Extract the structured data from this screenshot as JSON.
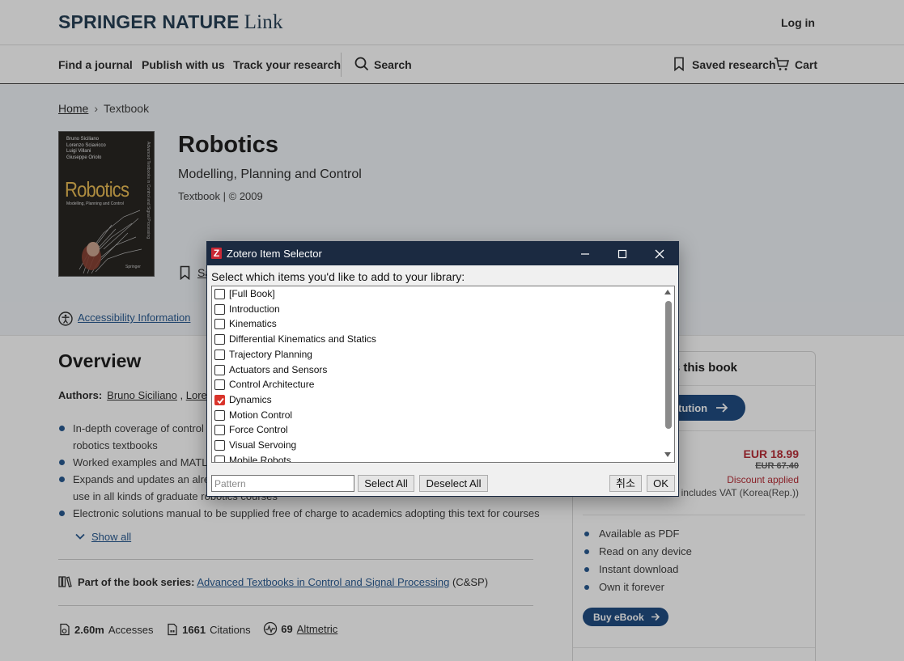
{
  "header": {
    "logo_brand": "SPRINGER NATURE",
    "logo_link": "Link",
    "login": "Log in"
  },
  "nav": {
    "find_journal": "Find a journal",
    "publish": "Publish with us",
    "track": "Track your research",
    "search": "Search",
    "saved": "Saved research",
    "cart": "Cart"
  },
  "breadcrumb": {
    "home": "Home",
    "current": "Textbook"
  },
  "cover": {
    "authors": [
      "Bruno Siciliano",
      "Lorenzo Sciavicco",
      "Luigi Villani",
      "Giuseppe Oriolo"
    ],
    "title": "Robotics",
    "subtitle": "Modelling, Planning and Control",
    "spine": "Advanced Textbooks in Control and Signal Processing",
    "publisher": "Springer"
  },
  "book": {
    "title": "Robotics",
    "subtitle": "Modelling, Planning and Control",
    "meta": "Textbook | © 2009",
    "save_peek": "Sa"
  },
  "accessibility": {
    "link": "Accessibility Information"
  },
  "overview": {
    "title": "Overview",
    "authors_label": "Authors:",
    "author1": "Bruno Siciliano",
    "author2_partial": "Loren",
    "bullets": [
      "In-depth coverage of control",
      "robotics textbooks",
      "Worked examples and MATLA",
      "Expands and updates an alrea",
      "use in all kinds of graduate robotics courses",
      "Electronic solutions manual to be supplied free of charge to academics adopting this text for courses"
    ],
    "show_all": "Show all",
    "series_label": "Part of the book series:",
    "series_link": "Advanced Textbooks in Control and Signal Processing",
    "series_abbr": "(C&SP)",
    "accesses_value": "2.60m",
    "accesses_label": "Accesses",
    "citations_value": "1661",
    "citations_label": "Citations",
    "altmetric_value": "69",
    "altmetric_label": "Altmetric"
  },
  "card": {
    "head_partial": "s this book",
    "inst_btn_partial": "tution",
    "price": "EUR 18.99",
    "old_price": "EUR 67.40",
    "discount": "Discount applied",
    "vat_partial": "ice includes VAT (Korea(Rep.))",
    "features": [
      "Available as PDF",
      "Read on any device",
      "Instant download",
      "Own it forever"
    ],
    "buy": "Buy eBook"
  },
  "dialog": {
    "title": "Zotero Item Selector",
    "instruction": "Select which items you'd like to add to your library:",
    "items": [
      {
        "label": "[Full Book]",
        "checked": false
      },
      {
        "label": "Introduction",
        "checked": false
      },
      {
        "label": "Kinematics",
        "checked": false
      },
      {
        "label": "Differential Kinematics and Statics",
        "checked": false
      },
      {
        "label": "Trajectory Planning",
        "checked": false
      },
      {
        "label": "Actuators and Sensors",
        "checked": false
      },
      {
        "label": "Control Architecture",
        "checked": false
      },
      {
        "label": "Dynamics",
        "checked": true
      },
      {
        "label": "Motion Control",
        "checked": false
      },
      {
        "label": "Force Control",
        "checked": false
      },
      {
        "label": "Visual Servoing",
        "checked": false
      },
      {
        "label": "Mobile Robots",
        "checked": false
      }
    ],
    "pattern_placeholder": "Pattern",
    "select_all": "Select All",
    "deselect_all": "Deselect All",
    "cancel": "취소",
    "ok": "OK"
  },
  "colors": {
    "brand_navy": "#18334a",
    "accent_blue": "#12417a",
    "price_red": "#b3202a",
    "dialog_title_bar": "#1b2a41",
    "zotero_red": "#cc2936",
    "check_red": "#d9342b"
  }
}
